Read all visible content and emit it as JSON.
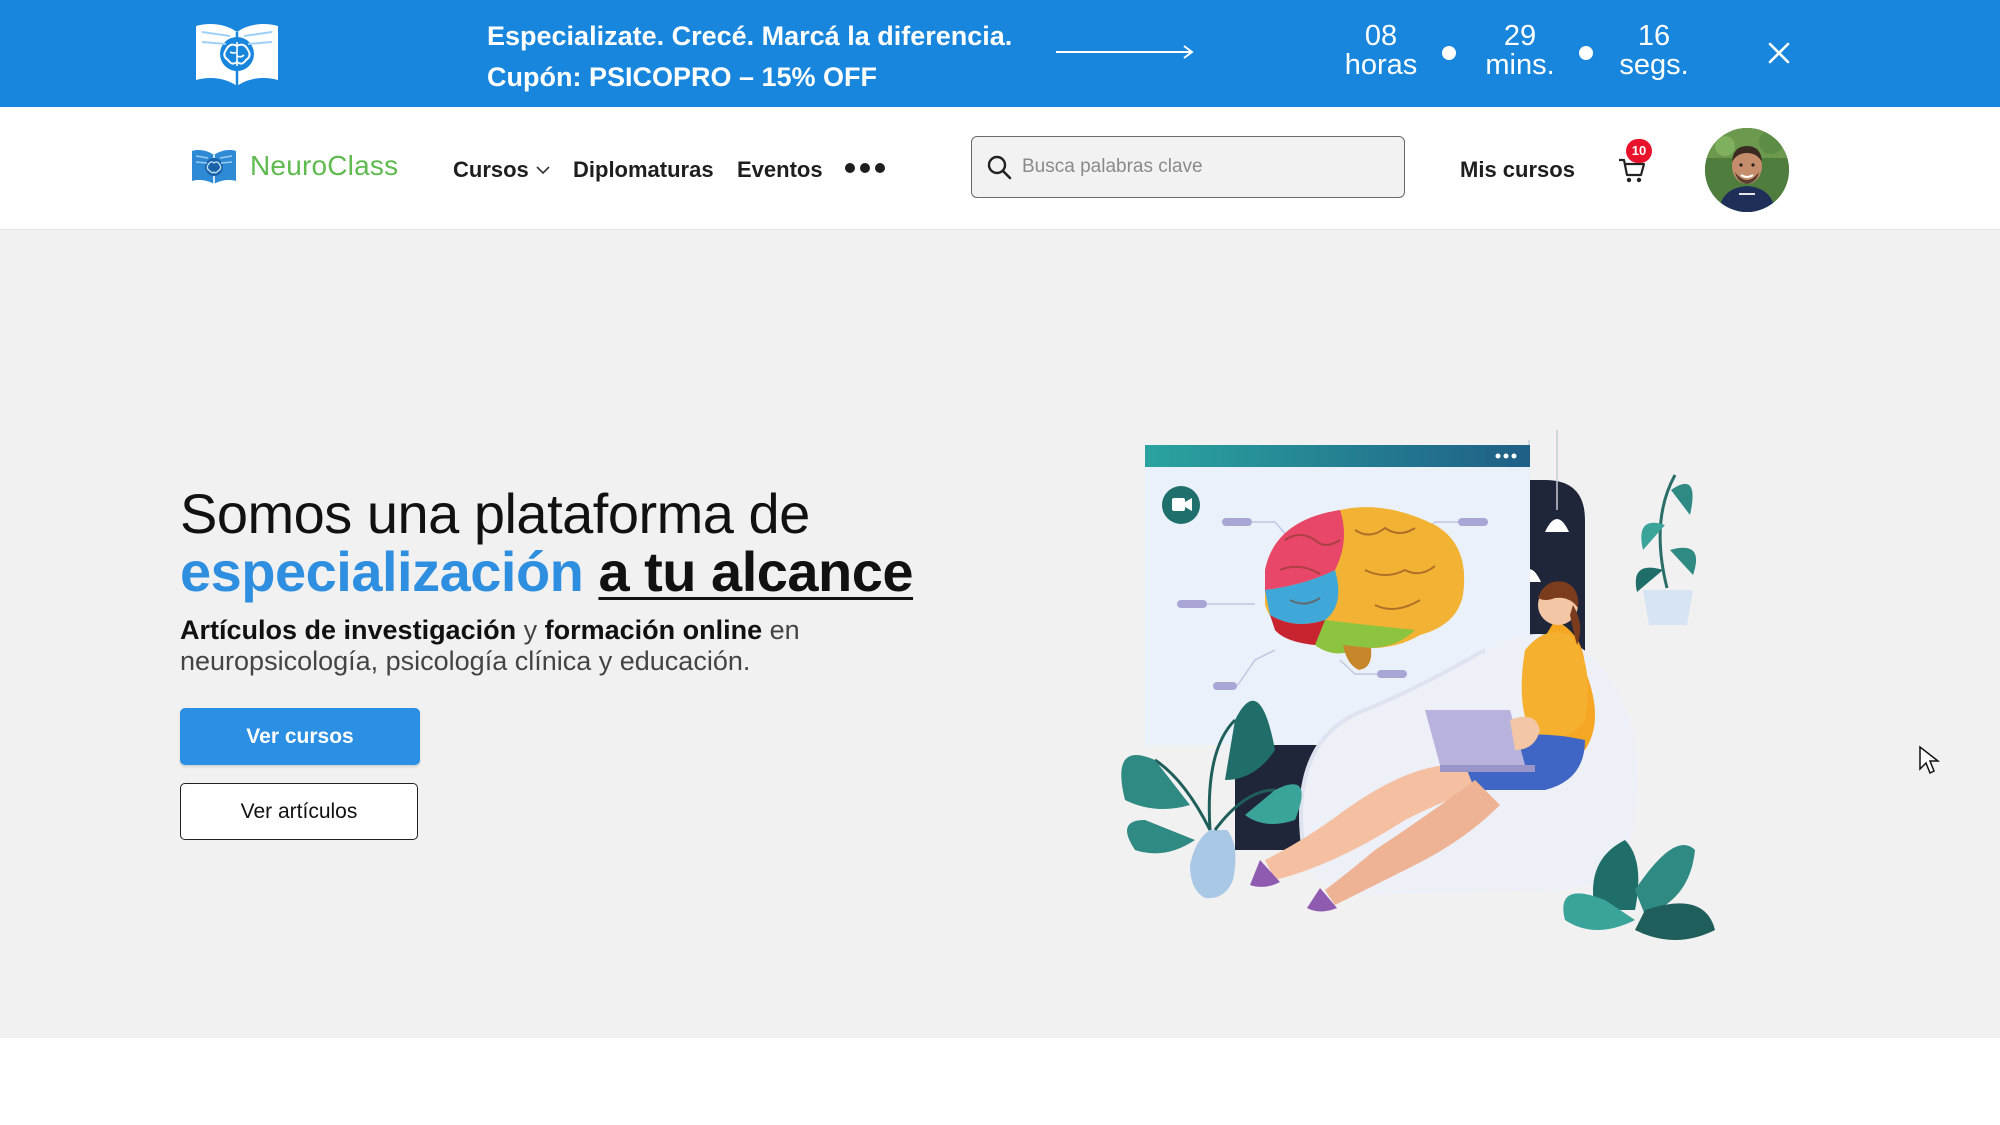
{
  "promo": {
    "line1": "Especializate. Crecé. Marcá la diferencia.",
    "line2": "Cupón: PSICOPRO – 15% OFF",
    "countdown": {
      "hours": "08",
      "hours_label": "horas",
      "minutes": "29",
      "minutes_label": "mins.",
      "seconds": "16",
      "seconds_label": "segs."
    },
    "close_icon": "close-icon"
  },
  "header": {
    "brand_name": "NeuroClass",
    "nav": {
      "cursos": "Cursos",
      "diplomaturas": "Diplomaturas",
      "eventos": "Eventos"
    },
    "search_placeholder": "Busca palabras clave",
    "mis_cursos": "Mis cursos",
    "cart_count": "10"
  },
  "hero": {
    "title_line1": "Somos una plataforma de",
    "title_blue": "especialización",
    "title_underlined": "a tu alcance",
    "sub_bold1": "Artículos de investigación",
    "sub_y": " y ",
    "sub_bold2": "formación online",
    "sub_rest1": " en",
    "sub_line2": "neuropsicología, psicología clínica y educación.",
    "btn_cursos": "Ver cursos",
    "btn_articulos": "Ver artículos"
  },
  "colors": {
    "promo_bg": "#1786dc",
    "brand_green": "#5fba4f",
    "accent_blue": "#2b8fe4",
    "badge_red": "#e8122b"
  }
}
